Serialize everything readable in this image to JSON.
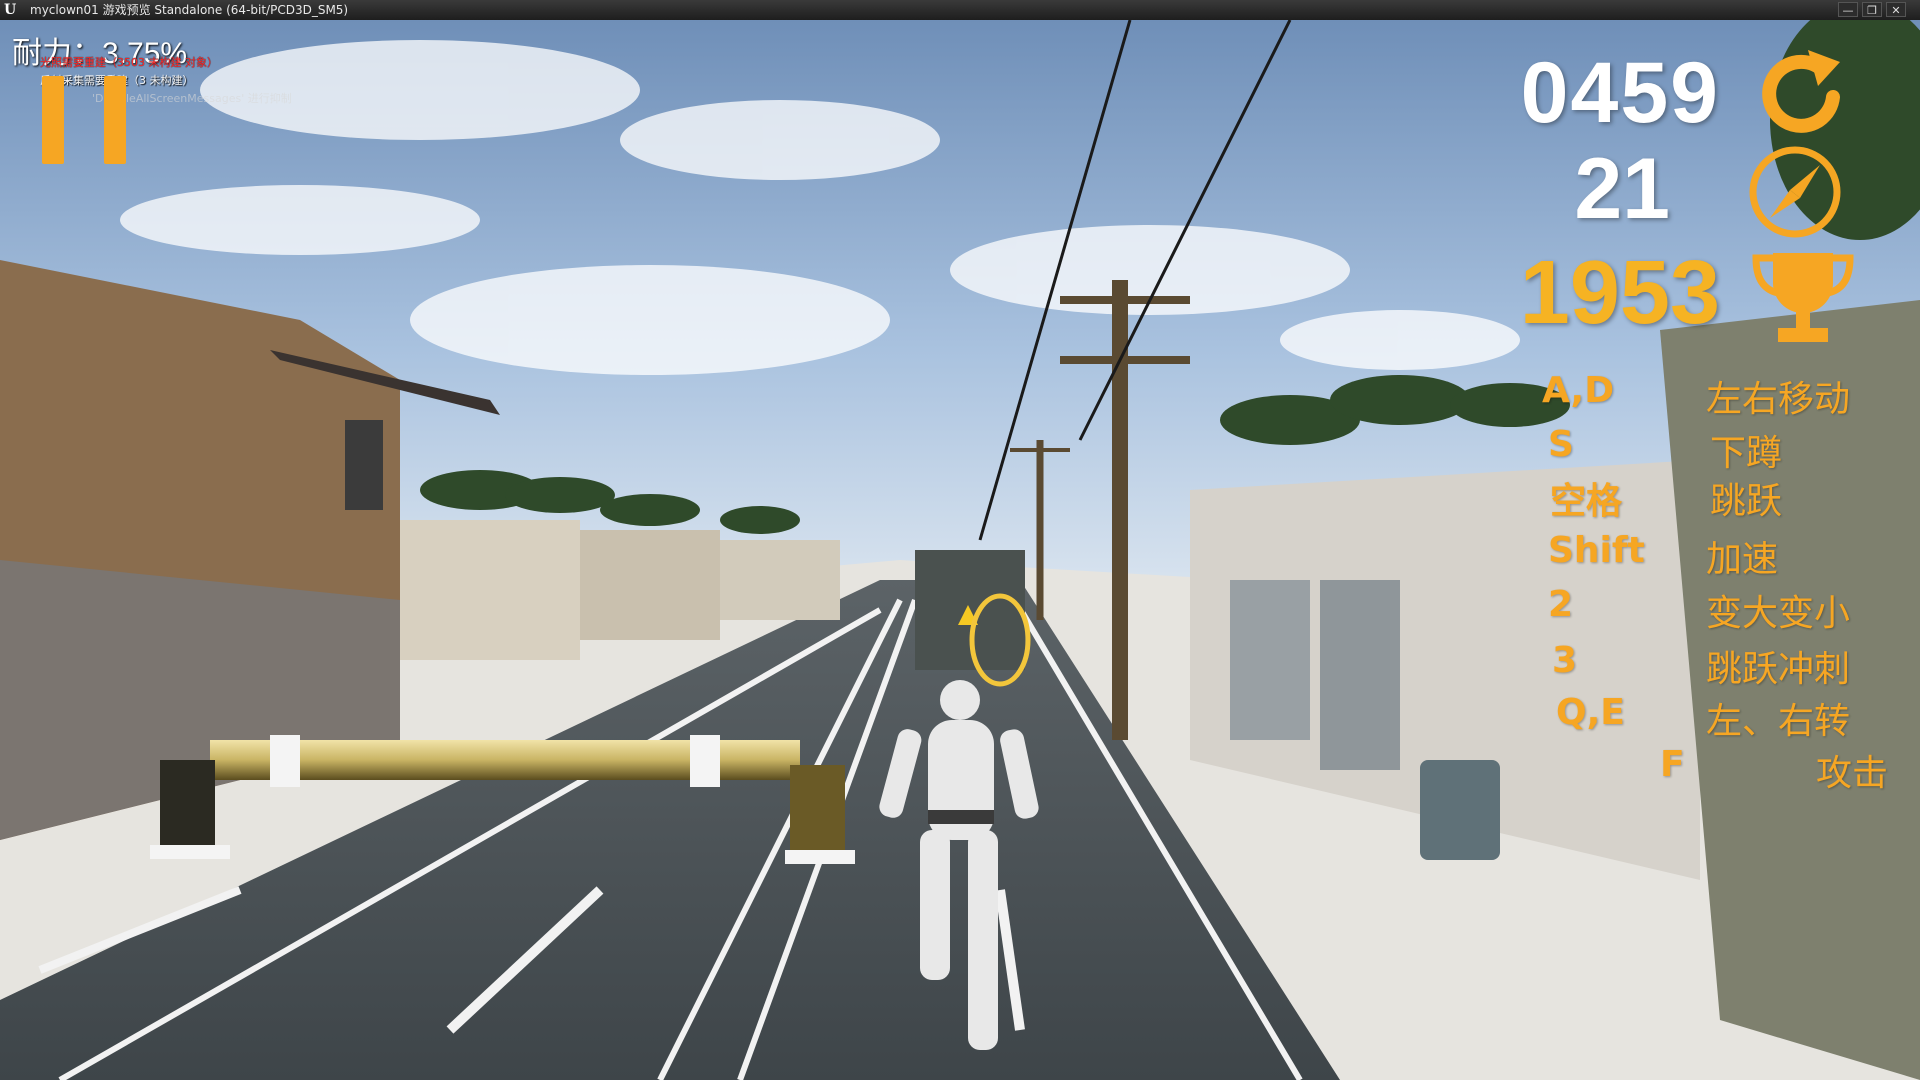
{
  "window": {
    "title": "myclown01 游戏预览 Standalone (64-bit/PCD3D_SM5)",
    "logo": "U",
    "buttons": {
      "minimize": "—",
      "maximize": "❐",
      "close": "✕"
    }
  },
  "hud": {
    "stamina_label": "耐力：3.75%",
    "stamina_percent": 3.75,
    "warnings": [
      "光照需要重建（3503 未构建 对象）",
      "反射采集需要重建（3 未构建）",
      "'DisableAllScreenMessages' 进行抑制"
    ],
    "score": "0459",
    "speed": "21",
    "best": "1953",
    "icons": {
      "pause": "pause-icon",
      "score": "refresh-icon",
      "speed": "speedometer-icon",
      "best": "trophy-icon"
    }
  },
  "controls": [
    {
      "key": "A,D",
      "desc": "左右移动"
    },
    {
      "key": "S",
      "desc": "下蹲"
    },
    {
      "key": "空格",
      "desc": "跳跃"
    },
    {
      "key": "Shift",
      "desc": "加速"
    },
    {
      "key": "2",
      "desc": "变大变小"
    },
    {
      "key": "3",
      "desc": "跳跃冲刺"
    },
    {
      "key": "Q,E",
      "desc": "左、右转"
    },
    {
      "key": "F",
      "desc": "攻击"
    }
  ],
  "colors": {
    "accent": "#f6a623",
    "warning": "#ff2a2a",
    "hud_text": "#ffffff"
  }
}
